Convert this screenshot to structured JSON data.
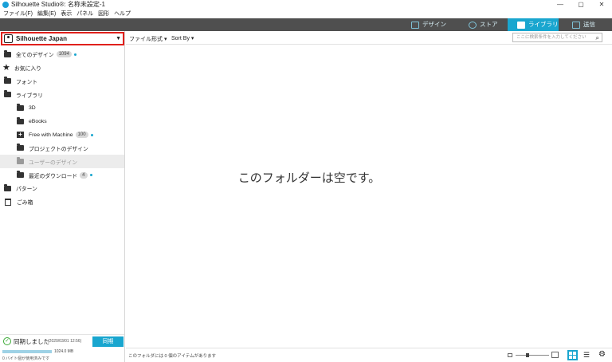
{
  "window": {
    "title": "Silhouette Studio®: 名称未設定-1",
    "min": "—",
    "max": "▢",
    "close": "✕"
  },
  "menu": [
    "ファイル(F)",
    "編集(E)",
    "表示",
    "パネル",
    "図形",
    "ヘルプ"
  ],
  "modules": [
    {
      "label": "デザイン",
      "active": false
    },
    {
      "label": "ストア",
      "active": false
    },
    {
      "label": "ライブラリ",
      "active": true
    },
    {
      "label": "送信",
      "active": false
    }
  ],
  "account": {
    "name": "Silhouette Japan"
  },
  "tree": [
    {
      "label": "全てのデザイン",
      "badge": "1094",
      "dot": true
    },
    {
      "label": "お気に入り"
    },
    {
      "label": "フォント"
    },
    {
      "label": "ライブラリ"
    },
    {
      "label": "3D"
    },
    {
      "label": "eBooks"
    },
    {
      "label": "Free with Machine",
      "badge": "100",
      "dot": true
    },
    {
      "label": "プロジェクトのデザイン"
    },
    {
      "label": "ユーザーのデザイン"
    },
    {
      "label": "最近のダウンロード",
      "badge": "4",
      "dot": true
    },
    {
      "label": "パターン"
    },
    {
      "label": "ごみ箱"
    }
  ],
  "sync": {
    "status": "同期しました",
    "date": "(2020/03/01 12:56)",
    "button": "同期",
    "storage_total": "1024.0 MB",
    "storage_used": "0 バイト個が使用済みです"
  },
  "toolbar": {
    "file_format": "ファイル形式",
    "sort": "Sort By",
    "search_placeholder": "ここに検索条件を入力してください"
  },
  "content": {
    "empty_message": "このフォルダーは空です。"
  },
  "status": {
    "text": "このフォルダには 0 個のアイテムがあります",
    "zoom_level": 0.35
  },
  "colors": {
    "accent": "#19a6cf",
    "module_bar": "#4f4f4f",
    "highlight_border": "#e0201c"
  }
}
